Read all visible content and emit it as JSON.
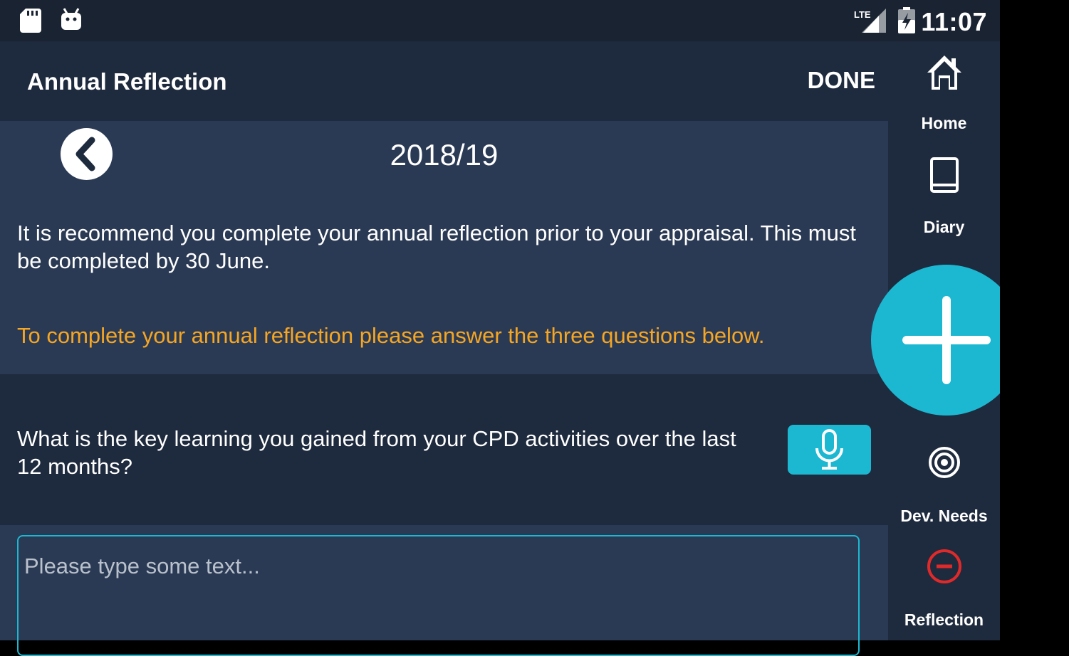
{
  "status_bar": {
    "time": "11:07",
    "left_icons": [
      "sd-card-icon",
      "android-icon"
    ],
    "right_icons": [
      "lte-signal-icon",
      "battery-charging-icon"
    ]
  },
  "app_bar": {
    "title": "Annual Reflection",
    "done_label": "DONE"
  },
  "content": {
    "year": "2018/19",
    "intro": "It is recommend you complete your annual reflection prior to your appraisal. This must be completed by 30 June.",
    "instruction": "To complete your annual reflection please answer the three questions below.",
    "question": "What is the key learning you gained from your CPD activities over the last 12 months?",
    "answer_placeholder": "Please type some text...",
    "answer_value": ""
  },
  "nav": {
    "items": [
      {
        "label": "Home",
        "icon": "home-icon"
      },
      {
        "label": "Diary",
        "icon": "book-icon"
      },
      {
        "label": "Dev. Needs",
        "icon": "target-icon"
      },
      {
        "label": "Reflection",
        "icon": "minus-circle-icon"
      }
    ],
    "fab_icon": "plus-icon"
  },
  "colors": {
    "accent": "#1cb8d2",
    "highlight_text": "#f5a623",
    "reflection_icon": "#e02a2a",
    "panel_dark": "#1e2a3d",
    "panel_light": "#2b3a54"
  }
}
